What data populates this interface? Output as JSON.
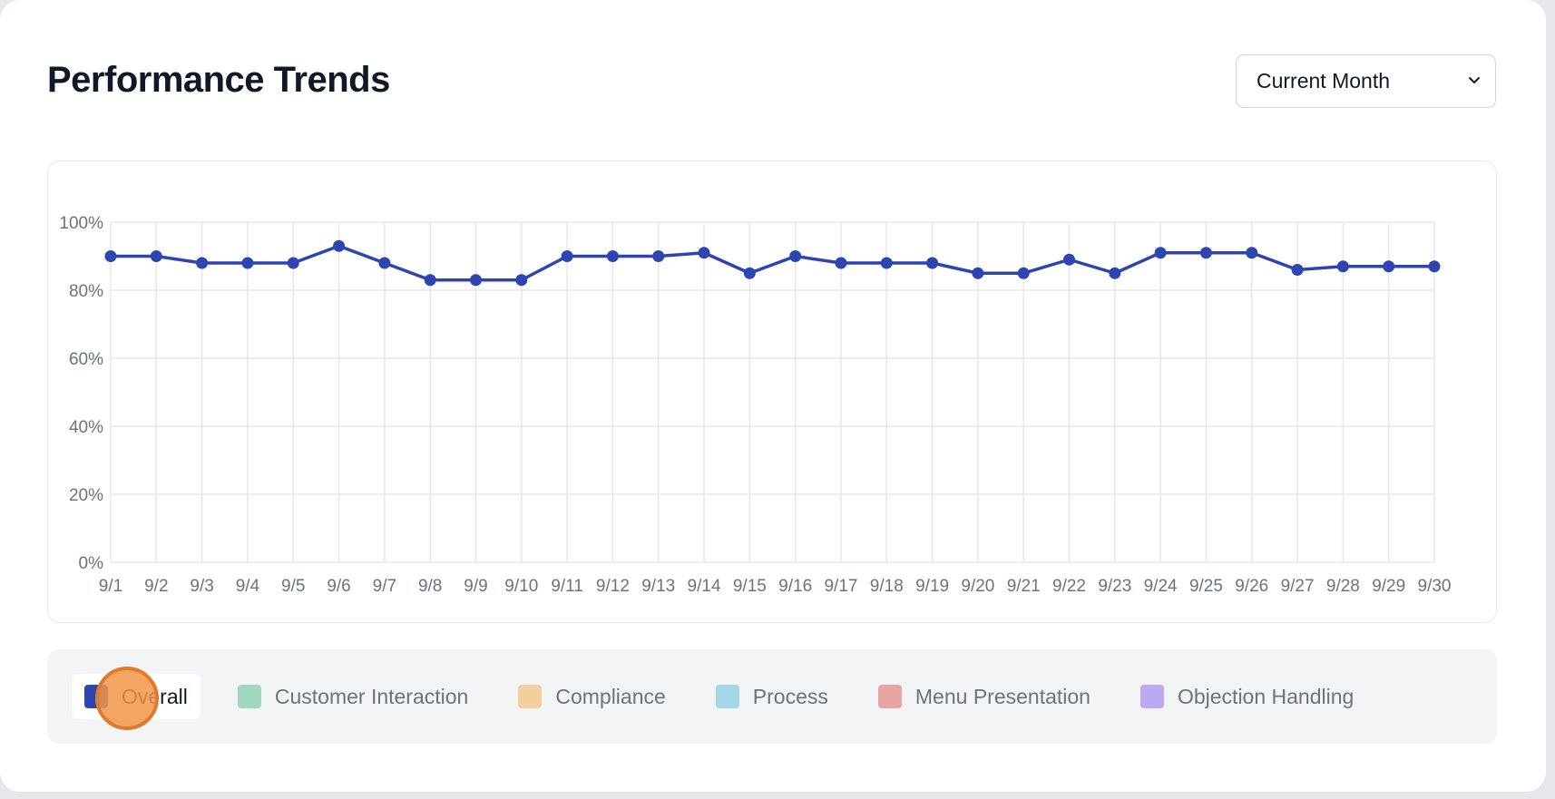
{
  "header": {
    "title": "Performance Trends"
  },
  "period_select": {
    "value": "Current Month",
    "icon": "chevron-down-icon"
  },
  "chart_data": {
    "type": "line",
    "categories": [
      "9/1",
      "9/2",
      "9/3",
      "9/4",
      "9/5",
      "9/6",
      "9/7",
      "9/8",
      "9/9",
      "9/10",
      "9/11",
      "9/12",
      "9/13",
      "9/14",
      "9/15",
      "9/16",
      "9/17",
      "9/18",
      "9/19",
      "9/20",
      "9/21",
      "9/22",
      "9/23",
      "9/24",
      "9/25",
      "9/26",
      "9/27",
      "9/28",
      "9/29",
      "9/30"
    ],
    "series": [
      {
        "name": "Overall",
        "color": "#2c45b0",
        "values": [
          90,
          90,
          88,
          88,
          88,
          93,
          88,
          83,
          83,
          83,
          90,
          90,
          90,
          91,
          85,
          90,
          88,
          88,
          88,
          85,
          85,
          89,
          85,
          91,
          91,
          91,
          86,
          87,
          87,
          87
        ]
      }
    ],
    "ylim": [
      0,
      100
    ],
    "yticks": [
      "0%",
      "20%",
      "40%",
      "60%",
      "80%",
      "100%"
    ],
    "grid": true
  },
  "legend": {
    "items": [
      {
        "label": "Overall",
        "color": "#2c45b0",
        "active": true
      },
      {
        "label": "Customer Interaction",
        "color": "#9fd8bd",
        "active": false
      },
      {
        "label": "Compliance",
        "color": "#f3cf9c",
        "active": false
      },
      {
        "label": "Process",
        "color": "#a3d7e5",
        "active": false
      },
      {
        "label": "Menu Presentation",
        "color": "#e9a3a3",
        "active": false
      },
      {
        "label": "Objection Handling",
        "color": "#bba9f3",
        "active": false
      }
    ]
  }
}
